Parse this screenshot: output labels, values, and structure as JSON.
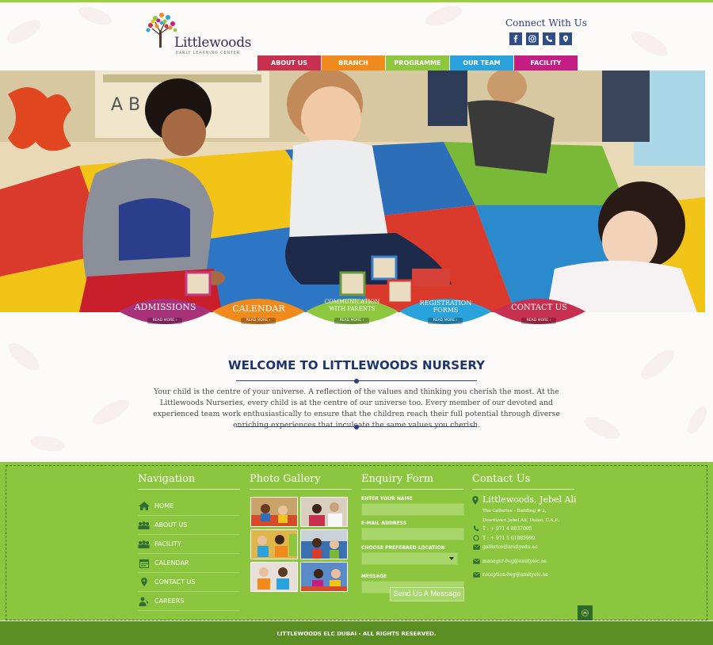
{
  "brand": {
    "name": "Littlewoods",
    "tagline": "EARLY LEARNING CENTER"
  },
  "header": {
    "connect_title": "Connect With Us",
    "social": [
      {
        "icon": "facebook-icon"
      },
      {
        "icon": "instagram-icon"
      },
      {
        "icon": "phone-icon"
      },
      {
        "icon": "location-icon"
      }
    ]
  },
  "nav": [
    {
      "label": "ABOUT US",
      "color": "#c8304f"
    },
    {
      "label": "BRANCH",
      "color": "#f08a1c"
    },
    {
      "label": "PROGRAMME",
      "color": "#8dc63f"
    },
    {
      "label": "OUR TEAM",
      "color": "#2aa3dc"
    },
    {
      "label": "FACILITY",
      "color": "#c41d83"
    }
  ],
  "quick_links": [
    {
      "line1": "ADMISSIONS",
      "line2": "",
      "read_more": "READ MORE ›",
      "color": "#a8317a"
    },
    {
      "line1": "CALENDAR",
      "line2": "",
      "read_more": "READ MORE ›",
      "color": "#f08a1c"
    },
    {
      "line1": "COMMUNICATION",
      "line2": "WITH PARENTS",
      "read_more": "READ MORE ›",
      "color": "#8dc63f"
    },
    {
      "line1": "REGISTRATION",
      "line2": "FORMS",
      "read_more": "READ MORE ›",
      "color": "#2aa3dc"
    },
    {
      "line1": "CONTACT US",
      "line2": "",
      "read_more": "READ MORE ›",
      "color": "#c8304f"
    }
  ],
  "welcome": {
    "title": "WELCOME TO LITTLEWOODS NURSERY",
    "text": "Your child is the centre of your universe. A reflection of the values and thinking you cherish the most. At the Littlewoods Nurseries, every child is at the centre of our universe too. Every member of our devoted and experienced team work enthusiastically to ensure that the children reach their full potential through diverse enriching experiences that inculcate the same values you cherish."
  },
  "footer": {
    "navigation_title": "Navigation",
    "gallery_title": "Photo Gallery",
    "form_title": "Enquiry Form",
    "contact_title": "Contact Us",
    "nav_items": [
      {
        "label": "HOME",
        "icon": "home-icon"
      },
      {
        "label": "ABOUT US",
        "icon": "group-icon"
      },
      {
        "label": "FACILITY",
        "icon": "group-icon"
      },
      {
        "label": "CALENDAR",
        "icon": "calendar-icon"
      },
      {
        "label": "CONTACT US",
        "icon": "location-icon"
      },
      {
        "label": "CAREERS",
        "icon": "careers-icon"
      }
    ],
    "form": {
      "name_label": "ENTER YOUR NAME",
      "email_label": "E-MAIL ADDRESS",
      "location_label": "CHOOSE PREFERRED LOCATION",
      "message_label": "MESSAGE",
      "submit_label": "Send Us A Message"
    },
    "contact": {
      "name": "Littlewoods, Jebel Ali",
      "address_line1": "The Galleries - Building # 2,",
      "address_line2": "Downtown Jebel Ali, Dubai, U.A.E.",
      "phone": "T : + 971 4 8837005",
      "whatsapp": "T : + 971 5 61885999",
      "email1": "galleries@amityedu.ae",
      "email2": "manager-lwg@amityelc.ae",
      "email3": "reception-lwg@amityelc.ae"
    }
  },
  "copyright": "LITTLEWOODS ELC DUBAI - ALL RIGHTS RESERVED."
}
